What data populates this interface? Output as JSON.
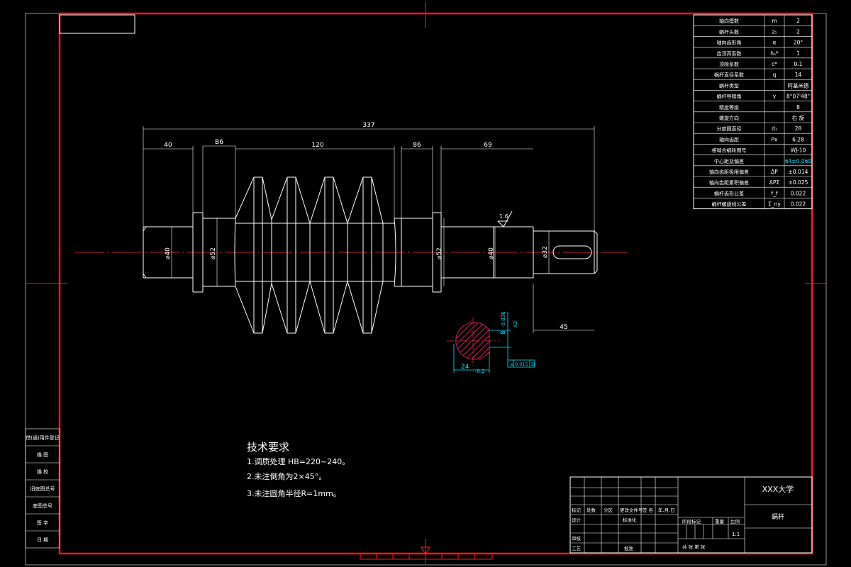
{
  "sheet": {
    "colors": {
      "border": "#ff1a1a",
      "lines": "#ffffff",
      "dimension_cyan": "#00e5ff",
      "hatch": "#c8205a"
    }
  },
  "params_table": [
    {
      "label": "轴向模数",
      "sym": "m",
      "val": "2"
    },
    {
      "label": "蜗杆头数",
      "sym": "z₁",
      "val": "2"
    },
    {
      "label": "轴向齿形角",
      "sym": "α",
      "val": "20°"
    },
    {
      "label": "齿顶高系数",
      "sym": "hₐ*",
      "val": "1"
    },
    {
      "label": "顶隙系数",
      "sym": "c*",
      "val": "0.1"
    },
    {
      "label": "蜗杆直径系数",
      "sym": "q",
      "val": "14"
    },
    {
      "label": "蜗杆类型",
      "sym": "",
      "val": "阿基米德"
    },
    {
      "label": "蜗杆导程角",
      "sym": "γ",
      "val": "8°07'48\""
    },
    {
      "label": "精度等级",
      "sym": "",
      "val": "8"
    },
    {
      "label": "螺旋方向",
      "sym": "",
      "val": "右 旋"
    },
    {
      "label": "分度圆直径",
      "sym": "d₁",
      "val": "28"
    },
    {
      "label": "轴向齿距",
      "sym": "Px",
      "val": "6.28"
    },
    {
      "label": "相啮合蜗轮图号",
      "sym": "",
      "val": "WJ-10"
    },
    {
      "label": "中心距及偏差",
      "sym": "",
      "val": "64±0.060"
    },
    {
      "label": "轴向齿距极限偏差",
      "sym": "ΔP",
      "val": "±0.014"
    },
    {
      "label": "轴向齿距累积偏差",
      "sym": "ΔPΣ",
      "val": "±0.025"
    },
    {
      "label": "蜗杆齿形公差",
      "sym": "f_f",
      "val": "0.022"
    },
    {
      "label": "蜗杆螺旋线公差",
      "sym": "Σ_ny",
      "val": "0.022"
    }
  ],
  "dims": {
    "total_length": "337",
    "seg1": "40",
    "seg2": "B6",
    "seg3": "120",
    "seg4": "86",
    "seg5": "69",
    "keyway_len": "45",
    "d1": "⌀40",
    "d2": "⌀52",
    "d3": "⌀52",
    "d4": "⌀40",
    "d5": "⌀32",
    "roughness": "1.6",
    "section_width": "24",
    "section_width_tol": "-0.2",
    "section_depth": "8",
    "section_depth_tol": "-0.036",
    "section_ref": "A2",
    "tolerance_frame": "0.015",
    "datum": "D"
  },
  "tech_requirements": {
    "title": "技术要求",
    "items": [
      "1.调质处理 HB=220~240。",
      "2.未注倒角为2×45°。",
      "3.未注圆角半径R=1mm。"
    ]
  },
  "left_strip": [
    "借(通)用件登记",
    "描 图",
    "描 校",
    "旧底图总号",
    "底图总号",
    "签 字",
    "日 期"
  ],
  "title_block": {
    "school": "XXX大学",
    "part_name": "蜗杆",
    "headers": [
      "标记",
      "处数",
      "分区",
      "更改文件号",
      "签 名",
      "年.月.日"
    ],
    "rows": [
      "设计",
      "审核",
      "工艺"
    ],
    "std_label": "标准化",
    "approve_label": "批准",
    "stage_label": "阶段标记",
    "weight_label": "重量",
    "scale_label": "比例",
    "scale_value": "1:1",
    "sheets_label": "共 张 第 张"
  }
}
